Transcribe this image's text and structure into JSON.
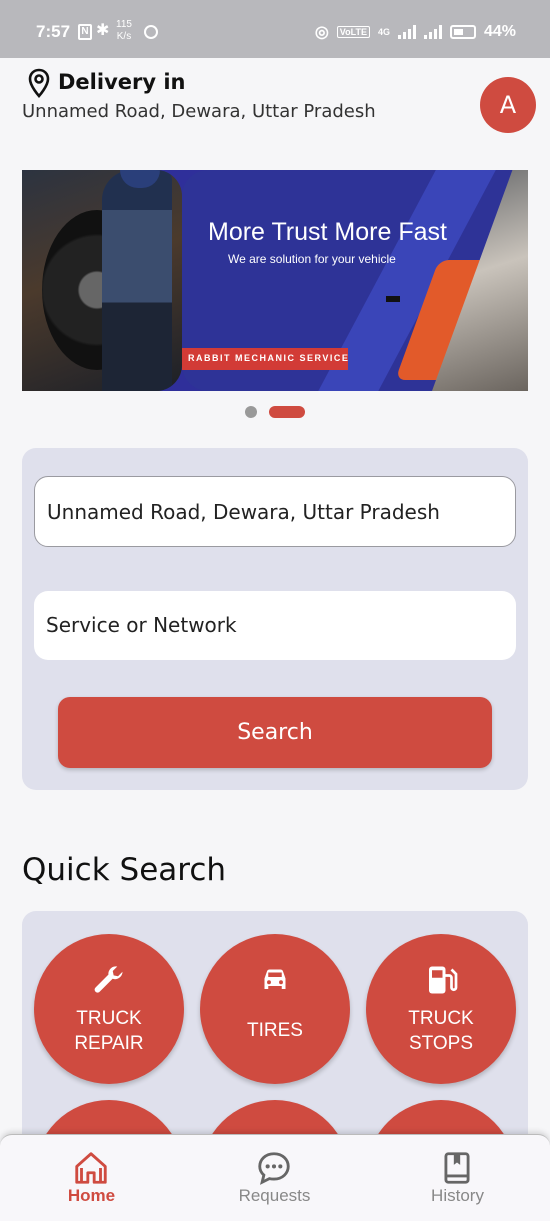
{
  "status_bar": {
    "time": "7:57",
    "nfc": "N",
    "speed_value": "115",
    "speed_unit": "K/s",
    "volte": "VoLTE",
    "network": "4G",
    "battery": "44%"
  },
  "header": {
    "delivery_label": "Delivery in",
    "address": "Unnamed Road, Dewara, Uttar Pradesh",
    "avatar_initial": "A"
  },
  "banner": {
    "title": "More Trust More Fast",
    "subtitle": "We are solution for your vehicle",
    "tag": "RABBIT MECHANIC SERVICE",
    "active_slide": 2,
    "slide_count": 2
  },
  "search": {
    "location_value": "Unnamed Road, Dewara, Uttar Pradesh",
    "service_placeholder": "Service or Network",
    "button_label": "Search"
  },
  "quick_search": {
    "title": "Quick Search",
    "items": [
      {
        "line1": "TRUCK",
        "line2": "REPAIR",
        "icon": "wrench-icon"
      },
      {
        "line1": "TIRES",
        "line2": "",
        "icon": "car-icon"
      },
      {
        "line1": "TRUCK",
        "line2": "STOPS",
        "icon": "fuel-pump-icon"
      }
    ]
  },
  "nav": {
    "items": [
      {
        "label": "Home",
        "icon": "home-icon",
        "active": true
      },
      {
        "label": "Requests",
        "icon": "chat-icon",
        "active": false
      },
      {
        "label": "History",
        "icon": "book-icon",
        "active": false
      }
    ]
  },
  "colors": {
    "accent": "#cf4b40",
    "card_bg": "#dfe0ec",
    "banner_blue": "#2e3397"
  }
}
